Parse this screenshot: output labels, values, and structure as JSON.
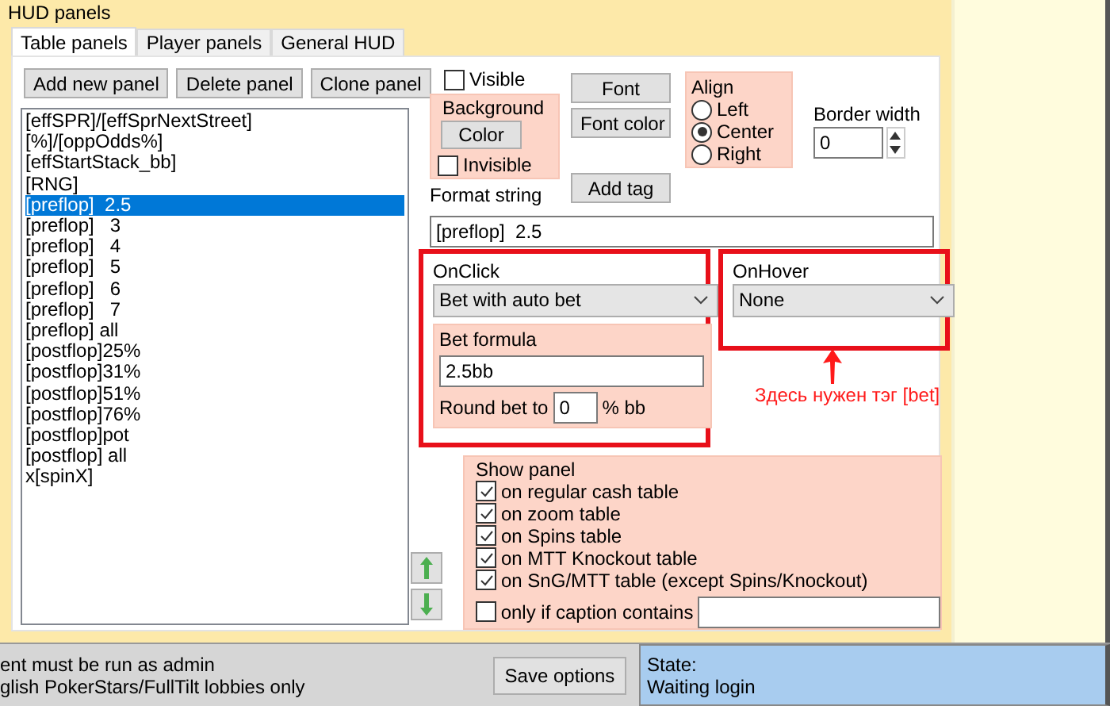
{
  "group_title": "HUD panels",
  "tabs": [
    {
      "label": "Table panels",
      "selected": true
    },
    {
      "label": "Player panels",
      "selected": false
    },
    {
      "label": "General HUD",
      "selected": false
    }
  ],
  "panel_buttons": [
    "Add new panel",
    "Delete panel",
    "Clone panel"
  ],
  "panel_list": [
    {
      "label": "[effSPR]/[effSprNextStreet]",
      "selected": false
    },
    {
      "label": "[%]/[oppOdds%]",
      "selected": false
    },
    {
      "label": "[effStartStack_bb]",
      "selected": false
    },
    {
      "label": "[RNG]",
      "selected": false
    },
    {
      "label": "[preflop]  2.5",
      "selected": true
    },
    {
      "label": "[preflop]   3",
      "selected": false
    },
    {
      "label": "[preflop]   4",
      "selected": false
    },
    {
      "label": "[preflop]   5",
      "selected": false
    },
    {
      "label": "[preflop]   6",
      "selected": false
    },
    {
      "label": "[preflop]   7",
      "selected": false
    },
    {
      "label": "[preflop] all",
      "selected": false
    },
    {
      "label": "[postflop]25%",
      "selected": false
    },
    {
      "label": "[postflop]31%",
      "selected": false
    },
    {
      "label": "[postflop]51%",
      "selected": false
    },
    {
      "label": "[postflop]76%",
      "selected": false
    },
    {
      "label": "[postflop]pot",
      "selected": false
    },
    {
      "label": "[postflop] all",
      "selected": false
    },
    {
      "label": "x[spinX]",
      "selected": false
    }
  ],
  "visible": {
    "label": "Visible",
    "checked": false
  },
  "background": {
    "title": "Background",
    "button": "Color",
    "invisible": {
      "label": "Invisible",
      "checked": false
    }
  },
  "font_buttons": [
    "Font",
    "Font color"
  ],
  "add_tag": "Add tag",
  "align": {
    "title": "Align",
    "options": [
      {
        "label": "Left",
        "selected": false
      },
      {
        "label": "Center",
        "selected": true
      },
      {
        "label": "Right",
        "selected": false
      }
    ]
  },
  "border_width": {
    "label": "Border width",
    "value": "0"
  },
  "format_string": {
    "label": "Format string",
    "value": "[preflop]  2.5"
  },
  "on_click": {
    "label": "OnClick",
    "value": "Bet with auto bet",
    "highlighted": true,
    "bet_formula": {
      "label": "Bet formula",
      "value": "2.5bb"
    },
    "round": {
      "label": "Round bet to",
      "value": "0",
      "unit": "% bb"
    }
  },
  "on_hover": {
    "label": "OnHover",
    "value": "None",
    "highlighted": true
  },
  "annotation": "Здесь нужен тэг [bet]",
  "show_panel": {
    "title": "Show panel",
    "options": [
      {
        "label": "on regular cash table",
        "checked": true
      },
      {
        "label": "on zoom table",
        "checked": true
      },
      {
        "label": "on Spins table",
        "checked": true
      },
      {
        "label": "on MTT Knockout table",
        "checked": true
      },
      {
        "label": "on SnG/MTT table (except Spins/Knockout)",
        "checked": true
      }
    ],
    "caption_filter": {
      "label": "only if caption contains",
      "checked": false
    }
  },
  "status": {
    "messages": [
      "ent must be run as admin",
      "glish PokerStars/FullTilt lobbies only"
    ],
    "save_button": "Save options",
    "state_label": "State:",
    "state_value": "Waiting login"
  }
}
